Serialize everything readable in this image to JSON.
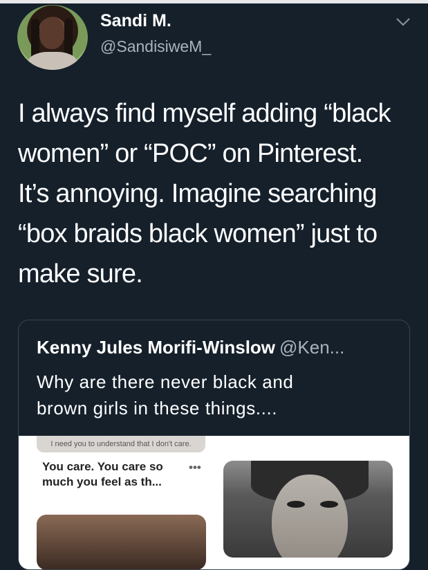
{
  "tweet": {
    "display_name": "Sandi M.",
    "handle": "@SandisiweM_",
    "lines": [
      "I always find myself adding “black",
      "women” or “POC” on Pinterest.",
      "It’s annoying. Imagine searching",
      "“box braids black women” just to",
      "make sure."
    ]
  },
  "quote": {
    "author": "Kenny Jules Morifi-Winslow",
    "handle": "@Ken...",
    "lines": [
      "Why are there never black and",
      "brown girls in these things...."
    ],
    "media": {
      "strip_text": "I need you to understand that I don't care.",
      "caption_lines": [
        "You care. You care so",
        "much you feel as th..."
      ],
      "more_label": "•••"
    }
  },
  "icons": {
    "chevron": "chevron-down-icon",
    "avatar": "avatar"
  },
  "colors": {
    "background": "#15202b",
    "secondary_text": "#a9b4bf",
    "border": "#38444d"
  }
}
